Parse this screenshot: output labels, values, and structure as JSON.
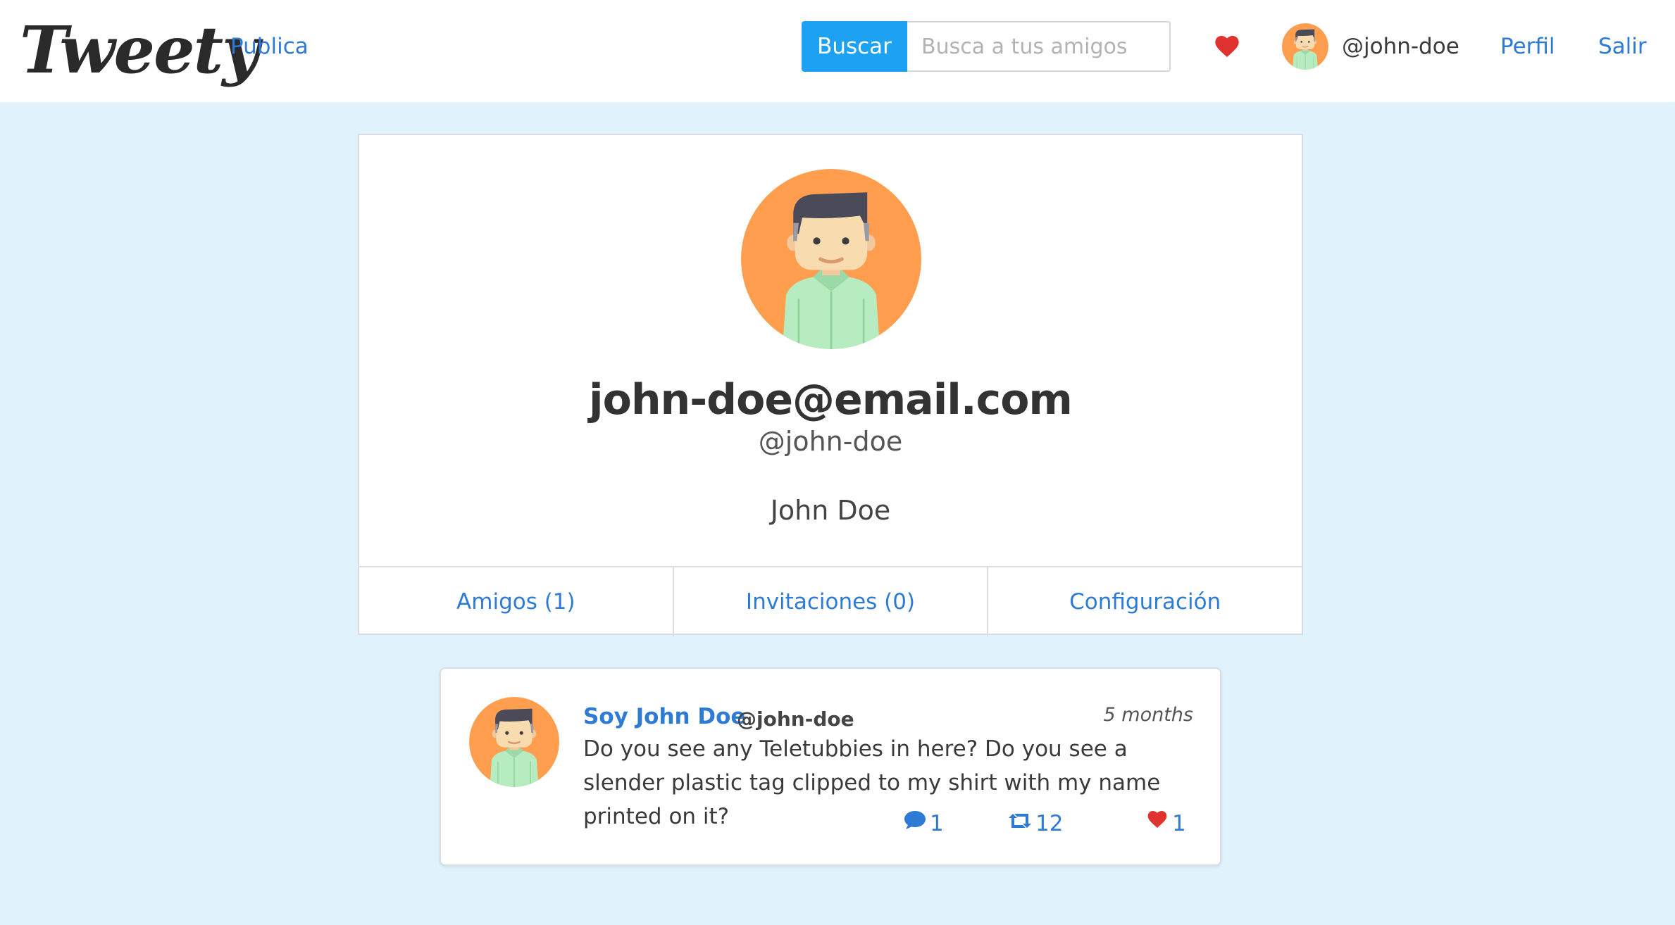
{
  "navbar": {
    "brand": "Tweety",
    "publish_label": "Publica",
    "search_button_label": "Buscar",
    "search_placeholder": "Busca a tus amigos",
    "search_value": "",
    "heart_icon": "heart-icon",
    "user_handle": "@john-doe",
    "profile_label": "Perfil",
    "logout_label": "Salir"
  },
  "profile": {
    "email": "john-doe@email.com",
    "handle": "@john-doe",
    "name": "John Doe",
    "tabs": [
      {
        "label": "Amigos (1)"
      },
      {
        "label": "Invitaciones (0)"
      },
      {
        "label": "Configuración"
      }
    ]
  },
  "tweet": {
    "author": "Soy John Doe",
    "handle": "@john-doe",
    "time": "5 months",
    "text": "Do you see any Teletubbies in here? Do you see a slender plastic tag clipped to my shirt with my name printed on it?",
    "comments": "1",
    "retweets": "12",
    "likes": "1"
  },
  "colors": {
    "accent": "#2e7bd6",
    "search_button": "#1da1f2",
    "heart": "#e0322e",
    "page_background": "#e0f3fc",
    "avatar_background": "#ff9e4f"
  }
}
